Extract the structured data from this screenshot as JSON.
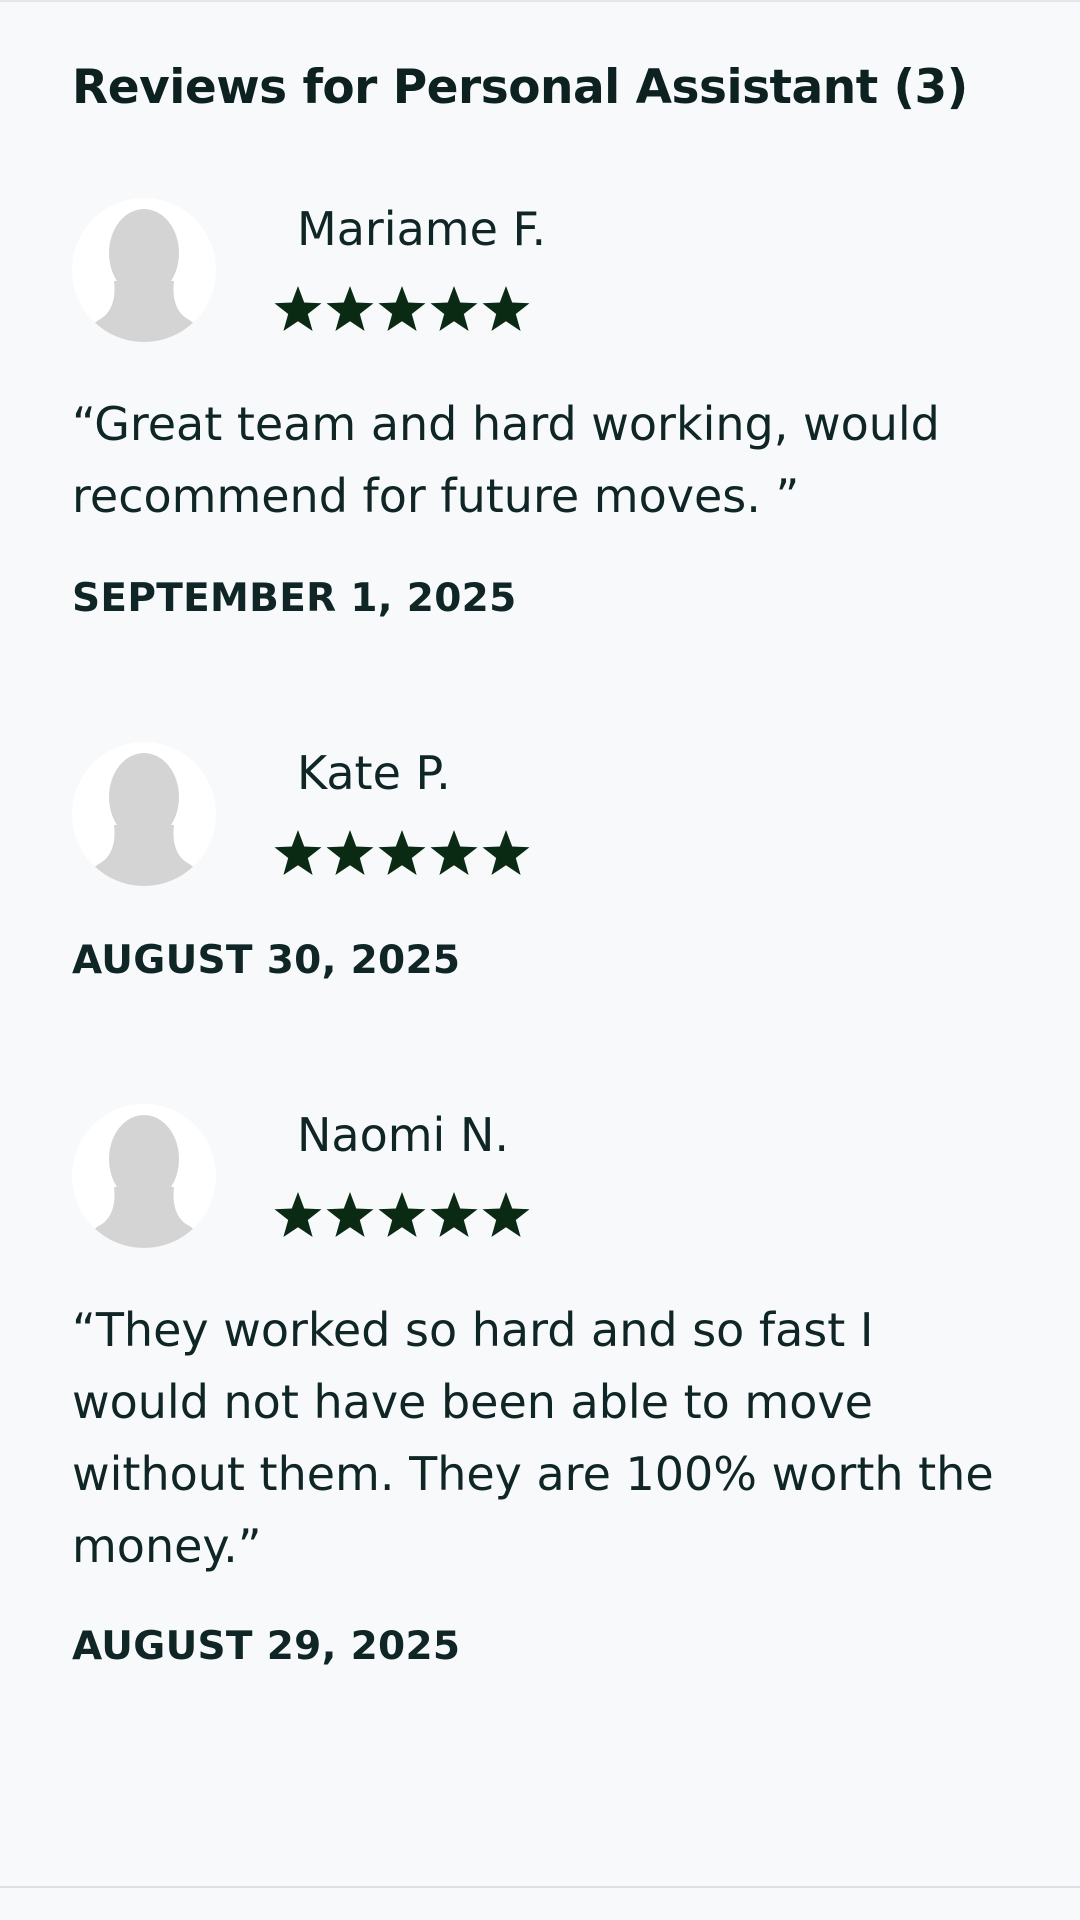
{
  "section": {
    "title": "Reviews for Personal Assistant (3)"
  },
  "icons": {
    "avatar": "default-user-avatar-icon",
    "star": "star-icon"
  },
  "colors": {
    "background": "#f8f9fb",
    "text": "#0d2121",
    "star": "#0b2a14",
    "avatar": "#d4d4d4"
  },
  "reviews": [
    {
      "name": "Mariame F.",
      "rating": 5,
      "text": "“Great team and hard working, would recommend for future moves. ”",
      "date": "SEPTEMBER 1, 2025"
    },
    {
      "name": "Kate P.",
      "rating": 5,
      "text": "",
      "date": "AUGUST 30, 2025"
    },
    {
      "name": "Naomi N.",
      "rating": 5,
      "text": "“They worked so hard and so fast I would not have been able to move without them. They are 100% worth the money.”",
      "date": "AUGUST 29, 2025"
    }
  ]
}
